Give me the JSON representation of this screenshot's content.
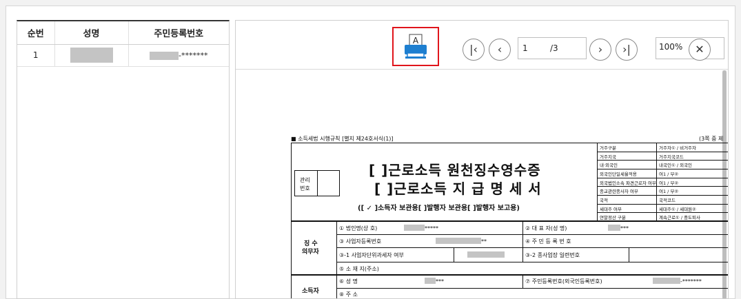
{
  "list": {
    "headers": [
      "순번",
      "성명",
      "주민등록번호"
    ],
    "rows": [
      {
        "no": "1",
        "rrn_suffix": "-*******"
      }
    ]
  },
  "toolbar": {
    "print_icon": "print-icon",
    "first_icon": "first-page-icon",
    "prev_icon": "prev-page-icon",
    "next_icon": "next-page-icon",
    "last_icon": "last-page-icon",
    "close_icon": "close-icon",
    "page_current": "1",
    "page_total": "/3",
    "zoom": "100%"
  },
  "form": {
    "header_left": "■ 소득세법 시행규칙 [별지 제24호서식(1)]",
    "header_right": "(3쪽 중 제",
    "mgmt_label1": "관리",
    "mgmt_label2": "번호",
    "title1": "[  ]근로소득 원천징수영수증",
    "title2": "[  ]근로소득 지 급 명 세 서",
    "subtitle": "([ ✓ ]소득자 보관용[     ]발행자 보관용[     ]발행자 보고용)",
    "right_rows": [
      [
        "거주구분",
        "거주자① / 비거주자"
      ],
      [
        "거주지국",
        "거주지국코드"
      ],
      [
        "내·외국인",
        "내국인① / 외국인"
      ],
      [
        "외국인단일세율적용",
        "여1 / 부②"
      ],
      [
        "외국법인소속 파견근로자 여부",
        "여1 / 부②"
      ],
      [
        "종교관련종사자 여부",
        "여1 / 부②"
      ],
      [
        "국적",
        "국적코드"
      ],
      [
        "세대주 여부",
        "세대주① / 세대원②"
      ],
      [
        "연말정산 구분",
        "계속근로① / 중도퇴사"
      ]
    ],
    "payer_label1": "징 수",
    "payer_label2": "의무자",
    "earner_label": "소득자",
    "payer_rows": {
      "corp_name": "① 법인명(상  호)",
      "corp_name_mask": "*****",
      "ceo": "② 대 표 자(성   명)",
      "ceo_mask": "***",
      "biz_no": "③ 사업자등록번호",
      "biz_no_mask": "**",
      "rrn": "④ 주 민 등 록 번 호",
      "unit_tax": "③-1 사업자단위과세자 여부",
      "sub_biz": "③-2 종사업장 일련번호",
      "address": "⑤ 소 재 지(주소)"
    },
    "earner_rows": {
      "name": "⑥ 성        명",
      "name_mask": "***",
      "rrn": "⑦ 주민등록번호(외국인등록번호)",
      "rrn_mask": "-*******",
      "addr": "⑧ 주        소"
    }
  },
  "colors": {
    "highlight": "#e0141b",
    "print_icon_blue": "#1e7fd0"
  }
}
